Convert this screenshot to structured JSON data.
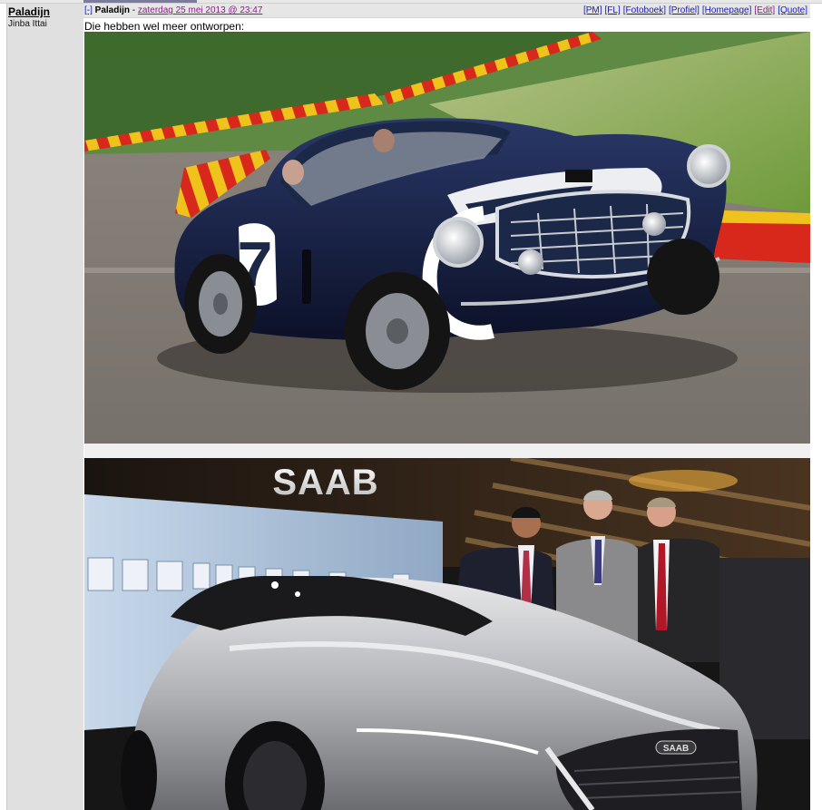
{
  "author": {
    "name": "Paladijn",
    "title": "Jinba Ittai"
  },
  "post": {
    "toggle": "[-]",
    "author": "Paladijn",
    "separator": " - ",
    "date": "zaterdag 25 mei 2013 @ 23:47",
    "actions": [
      "[PM]",
      "[FL]",
      "[Fotoboek]",
      "[Profiel]",
      "[Homepage]",
      "[Edit]",
      "[Quote]"
    ],
    "text": "Die hebben wel meer ontworpen:",
    "ferrari_number": "7",
    "saab_sign": "SAAB",
    "saab_badge": "SAAB"
  },
  "colors": {
    "link": "#1a1ab0",
    "visited": "#8a1c8a",
    "header_bg": "#e6e6e6",
    "sidebar_bg": "#e0e0e0"
  }
}
